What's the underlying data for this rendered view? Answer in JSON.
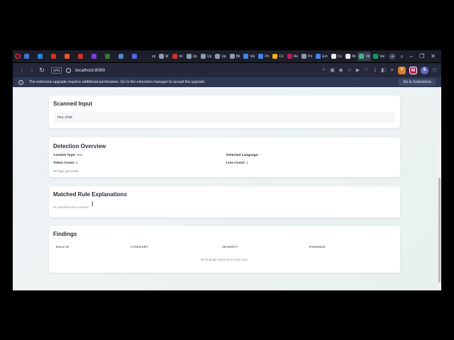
{
  "tabs": [
    {
      "label": "",
      "color": "#3a78d8"
    },
    {
      "label": "",
      "color": "#1e88e5"
    },
    {
      "label": "",
      "color": "#d93025"
    },
    {
      "label": "",
      "color": "#e8572e"
    },
    {
      "label": "",
      "color": "#d93025"
    },
    {
      "label": "",
      "color": "#7b3fe4"
    },
    {
      "label": "",
      "color": "#2e7d32"
    },
    {
      "label": "",
      "color": "#4f86c6"
    },
    {
      "label": "",
      "color": "#5865f2"
    },
    {
      "label": "vp",
      "color": "#1c1e2a"
    },
    {
      "label": "M",
      "color": "#8a9ab0"
    },
    {
      "label": "Inl",
      "color": "#d93025"
    },
    {
      "label": "Up",
      "color": "#8a9ab0"
    },
    {
      "label": "Up",
      "color": "#8a9ab0"
    },
    {
      "label": "Up",
      "color": "#8a9ab0"
    },
    {
      "label": "Bil",
      "color": "#8a9ab0"
    },
    {
      "label": "Val",
      "color": "#4285f4"
    },
    {
      "label": "Pri",
      "color": "#4285f4"
    },
    {
      "label": "Co",
      "color": "#f4b400"
    },
    {
      "label": "Re",
      "color": "#c2185b"
    },
    {
      "label": "Pri",
      "color": "#8a9ab0"
    },
    {
      "label": "Em",
      "color": "#4285f4"
    },
    {
      "label": "Co",
      "color": "#e8eaf0"
    },
    {
      "label": "Mi",
      "color": "#e8eaf0"
    },
    {
      "label": "Vit",
      "color": "#41b883",
      "active": true
    },
    {
      "label": "Val",
      "color": "#0f9d58"
    }
  ],
  "toolbar": {
    "vpn_label": "VPN",
    "url": "localhost:8080",
    "ext_y": "Y",
    "ext_m": "M",
    "ext_s": "S"
  },
  "infobar": {
    "message": "The extension upgrade requires additional permissions. Go to the extension manager to accept the upgrade.",
    "button": "Go to Extensions"
  },
  "scanned_input": {
    "title": "Scanned Input",
    "value": "hey chat"
  },
  "detection": {
    "title": "Detection Overview",
    "content_type_label": "Content Type:",
    "content_type": "text",
    "language_label": "Detected Language:",
    "language": "-",
    "token_label": "Token Count:",
    "token_count": "2",
    "line_label": "Line Count:",
    "line_count": "1",
    "flags_note": "No flags generated."
  },
  "rules": {
    "title": "Matched Rule Explanations",
    "empty": "No matched rules returned."
  },
  "findings": {
    "title": "Findings",
    "columns": [
      "RULE ID",
      "CATEGORY",
      "SEVERITY",
      "EVIDENCE"
    ],
    "empty": "No findings returned for this scan."
  }
}
